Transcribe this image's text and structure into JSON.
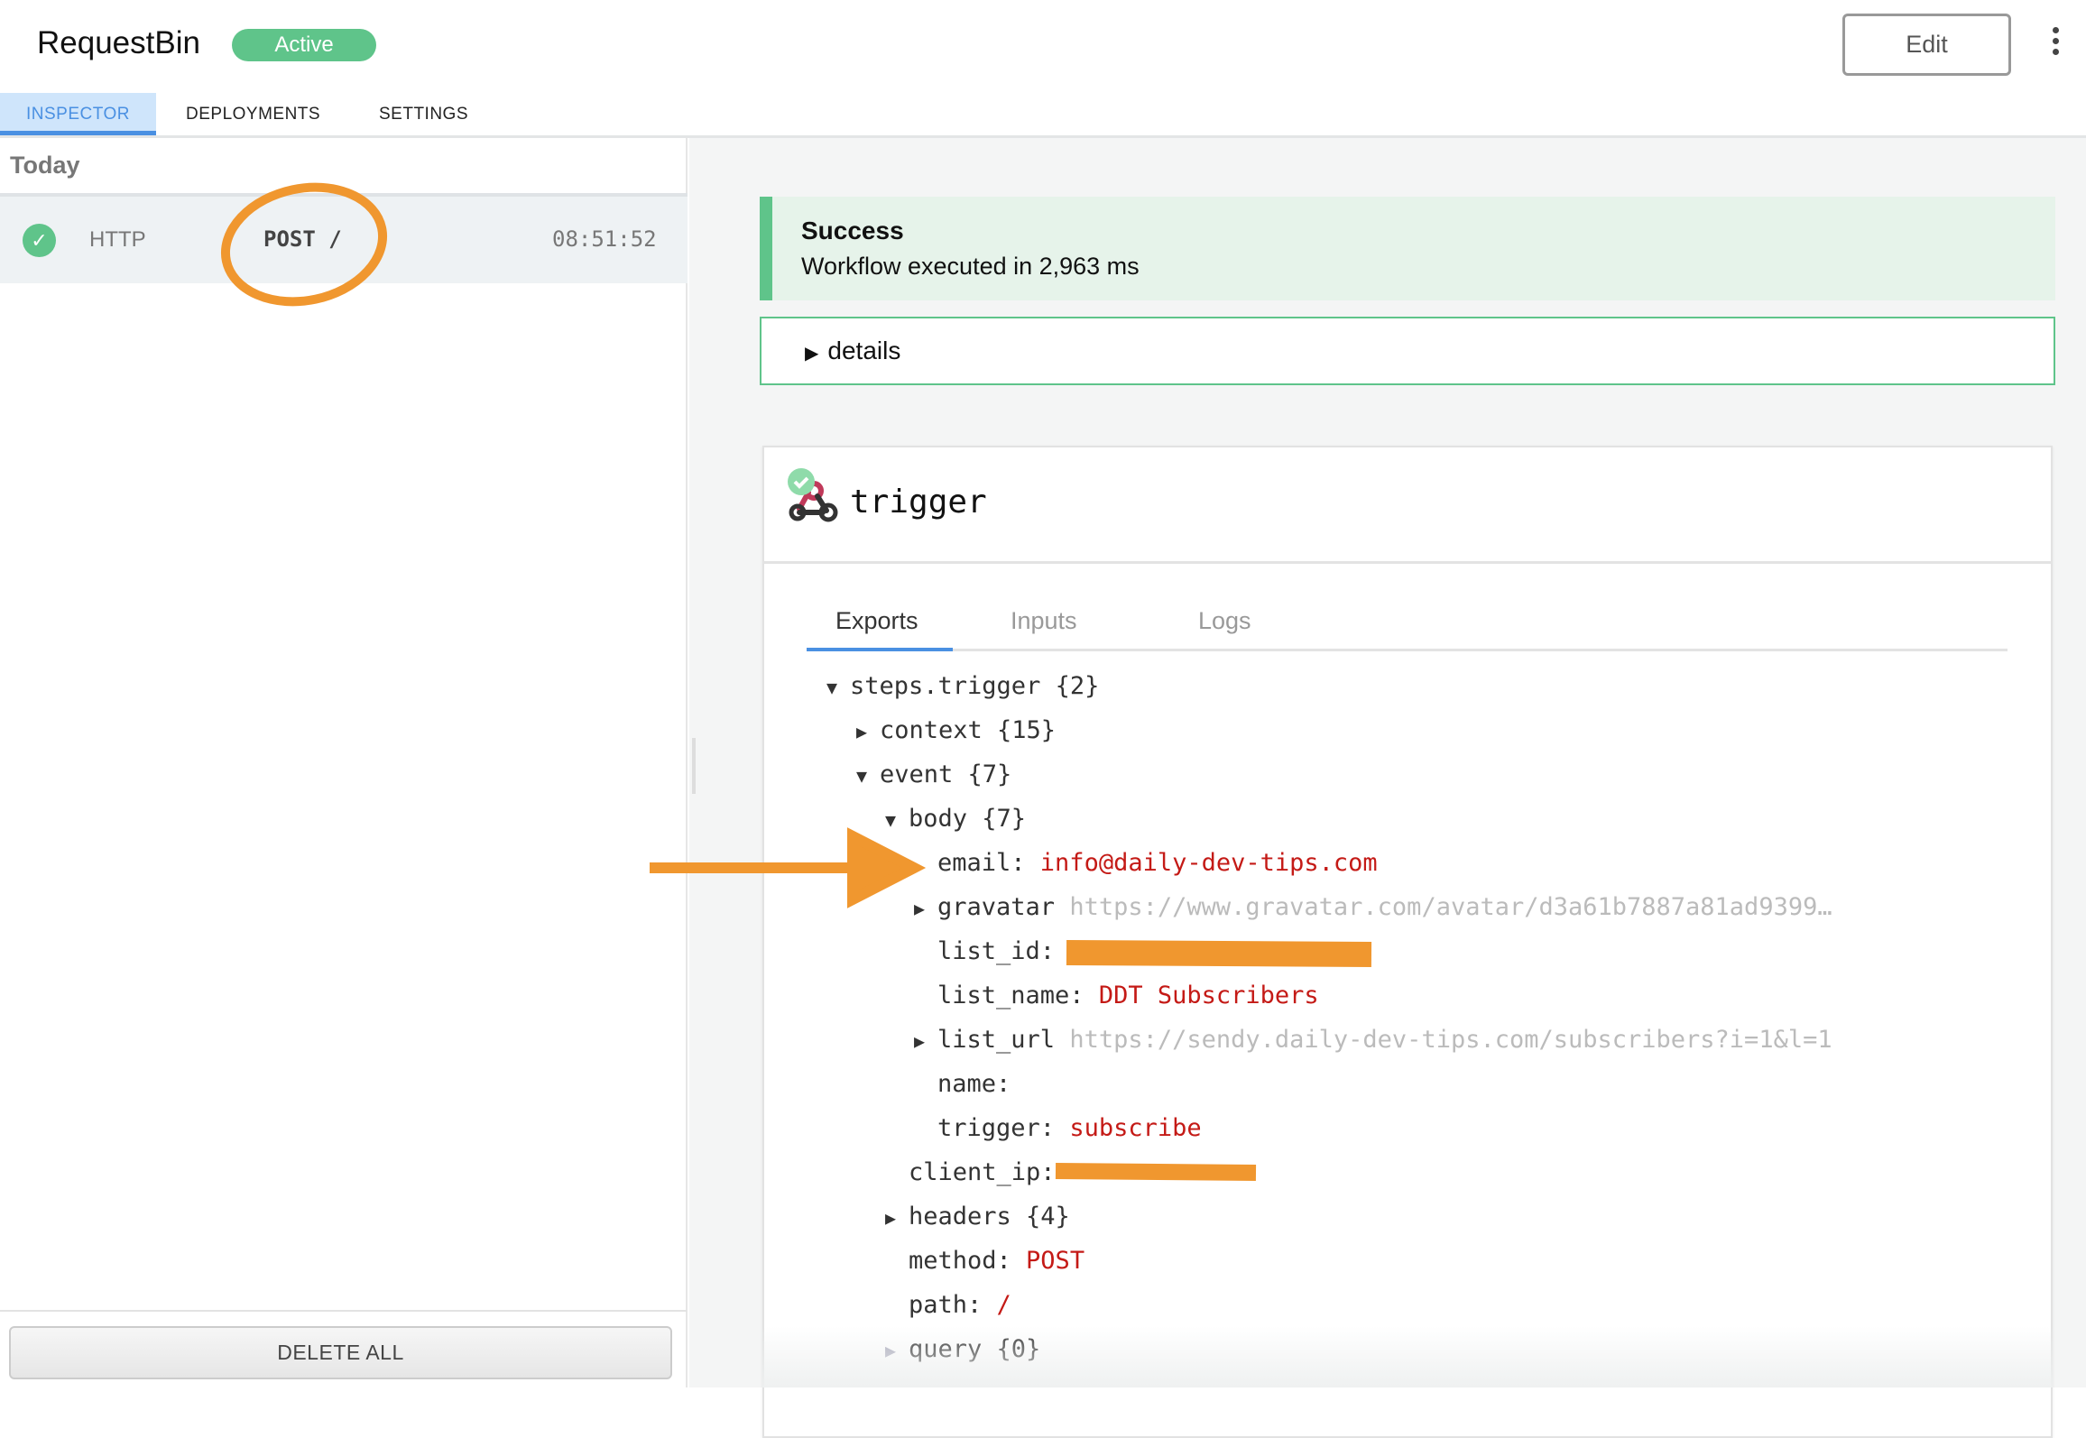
{
  "header": {
    "title": "RequestBin",
    "status": "Active",
    "edit_label": "Edit",
    "more_icon": "kebab-icon"
  },
  "tabs": [
    {
      "label": "INSPECTOR",
      "active": true
    },
    {
      "label": "DEPLOYMENTS"
    },
    {
      "label": "SETTINGS"
    }
  ],
  "sidebar": {
    "group": "Today",
    "events": [
      {
        "status": "success",
        "type": "HTTP",
        "request": "POST /",
        "time": "08:51:52"
      }
    ],
    "delete_all": "DELETE ALL"
  },
  "result": {
    "title": "Success",
    "message": "Workflow executed in 2,963 ms",
    "details": "details"
  },
  "step": {
    "name": "trigger",
    "icon": "webhook-icon",
    "tabs": [
      "Exports",
      "Inputs",
      "Logs"
    ],
    "active_tab": "Exports",
    "tree": [
      {
        "level": 0,
        "arrow": "down",
        "key": "steps.trigger {2}"
      },
      {
        "level": 1,
        "arrow": "right",
        "key": "context {15}"
      },
      {
        "level": 1,
        "arrow": "down",
        "key": "event {7}"
      },
      {
        "level": 2,
        "arrow": "down",
        "key": "body {7}"
      },
      {
        "level": 3,
        "key": "email: ",
        "value": "info@daily-dev-tips.com"
      },
      {
        "level": 3,
        "arrow": "right",
        "key": "gravatar ",
        "url": "https://www.gravatar.com/avatar/d3a61b7887a81ad9399…"
      },
      {
        "level": 3,
        "key": "list_id: ",
        "value": "",
        "redacted": true
      },
      {
        "level": 3,
        "key": "list_name: ",
        "value": "DDT Subscribers"
      },
      {
        "level": 3,
        "arrow": "right",
        "key": "list_url ",
        "url": "https://sendy.daily-dev-tips.com/subscribers?i=1&l=1"
      },
      {
        "level": 3,
        "key": "name:"
      },
      {
        "level": 3,
        "key": "trigger: ",
        "value": "subscribe"
      },
      {
        "level": 2,
        "key": "client_ip: ",
        "value": "",
        "redacted": true
      },
      {
        "level": 2,
        "arrow": "right",
        "key": "headers {4}"
      },
      {
        "level": 2,
        "key": "method: ",
        "value": "POST"
      },
      {
        "level": 2,
        "key": "path: ",
        "value": "/"
      },
      {
        "level": 2,
        "arrow": "right-dim",
        "key": "query {0}"
      }
    ]
  },
  "colors": {
    "accent": "#4a90e2",
    "success": "#5fc48a",
    "value": "#c41a16",
    "annotation": "#f0972f"
  }
}
